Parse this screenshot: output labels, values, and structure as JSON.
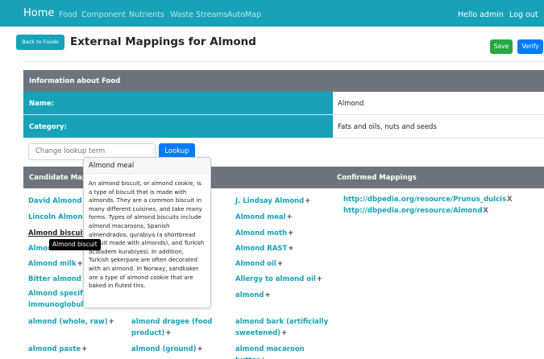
{
  "navbar": {
    "brand": "Home",
    "links": [
      "Food",
      "Component",
      "Nutrients",
      "Waste Streams",
      "AutoMap"
    ],
    "greeting": "Hello admin",
    "logout": "Log out"
  },
  "toolbar": {
    "back_label": "Back to Foods",
    "title": "External Mappings for Almond",
    "save_label": "Save",
    "verify_label": "Verify"
  },
  "info": {
    "header": "Information about Food",
    "rows": [
      {
        "label": "Name:",
        "value": "Almond"
      },
      {
        "label": "Category:",
        "value": "Fats and oils, nuts and seeds"
      }
    ]
  },
  "lookup": {
    "placeholder": "Change lookup term",
    "button_label": "Lookup"
  },
  "mappings": {
    "candidate_header": "Candidate Mapp",
    "confirmed_header": "Confirmed Mappings",
    "plus_symbol": "+",
    "remove_symbol": "X",
    "candidates_col1": [
      "David Almond",
      "Lincoln Almond",
      "Almond biscuit",
      "Almon",
      "Almond milk",
      "Bitter almond oi",
      "Almond specific",
      "immunoglobulin",
      "almond (whole, raw)",
      "almond paste"
    ],
    "candidates_col2": [
      "almond dragee (food",
      "product)",
      "almond (ground)"
    ],
    "candidates_col3": [
      "J. Lindsay Almond",
      "Almond meal",
      "Almond moth",
      "Almond RAST",
      "Almond oil",
      "Allergy to almond oil",
      "almond",
      "almond bark (artificially",
      "sweetened)",
      "almond macaroon",
      "butter"
    ],
    "confirmed": [
      "http://dbpedia.org/resource/Prunus_dulcis",
      "http://dbpedia.org/resource/Almond"
    ]
  },
  "popover": {
    "title": "Almond meal",
    "lines": [
      "An almond biscuit, or almond cookie, is",
      "a type of biscuit that is made with",
      "almonds. They are a common biscuit in",
      "many different cuisines, and take many",
      "forms. Types of almond biscuits include",
      "almond macaroons, Spanish",
      "almendrados, qurabiya (a shortbread",
      "biscuit made with almonds), and Turkish",
      "acıbadem kurabiyesi. In addition,",
      "Turkish şekerpare are often decorated",
      "with an almond. In Norway, sandkaker",
      "are a type of almond cookie that are",
      "baked in fluted tins."
    ]
  },
  "tooltip": {
    "text": "Almond biscuit"
  },
  "colors": {
    "primary": "#17a2b8",
    "header_gray": "#6c757d",
    "save_green": "#28a745",
    "verify_blue": "#007bff"
  }
}
